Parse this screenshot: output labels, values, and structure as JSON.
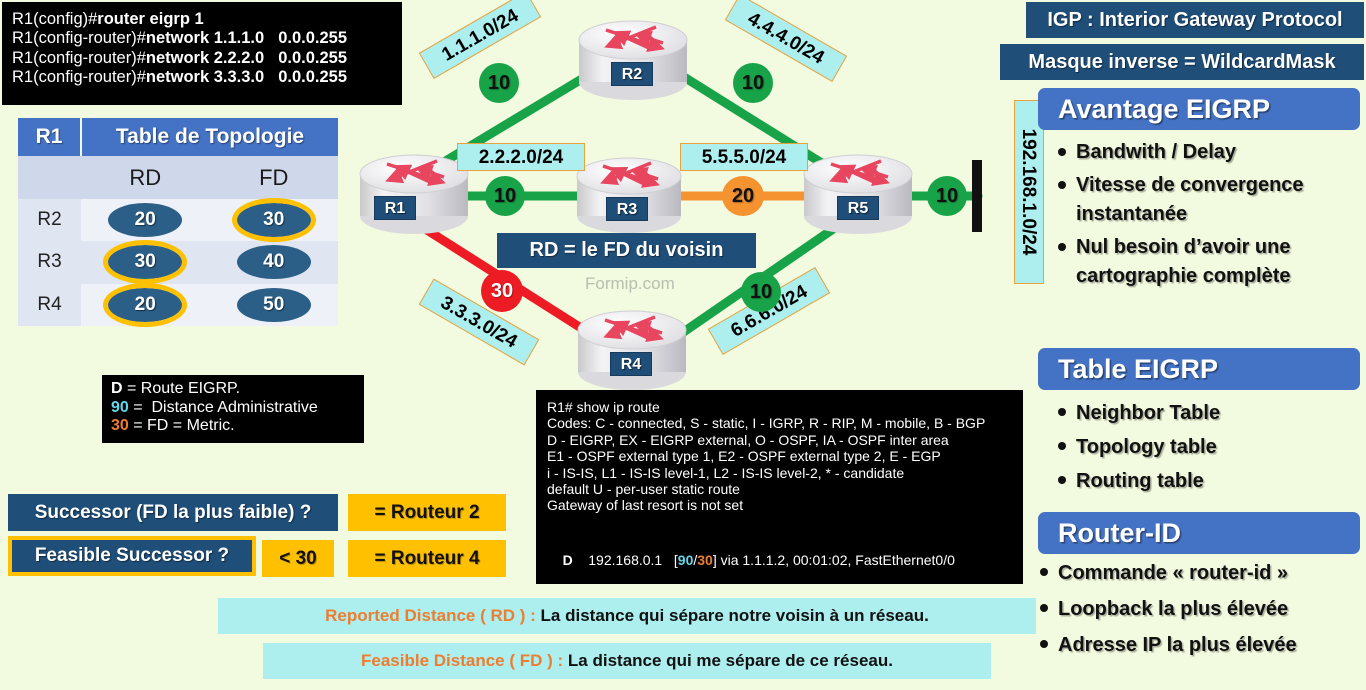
{
  "cli_config": {
    "name": "eigrp-config-terminal",
    "lines": [
      {
        "prompt": "R1(config)#",
        "cmd": "router eigrp 1",
        "mask": ""
      },
      {
        "prompt": "R1(config-router)#",
        "cmd": "network 1.1.1.0",
        "mask": "0.0.0.255"
      },
      {
        "prompt": "R1(config-router)#",
        "cmd": "network 2.2.2.0",
        "mask": "0.0.0.255"
      },
      {
        "prompt": "R1(config-router)#",
        "cmd": "network 3.3.3.0",
        "mask": "0.0.0.255"
      }
    ]
  },
  "topology_table": {
    "router_label": "R1",
    "title": "Table de Topologie",
    "col_headers": [
      "",
      "RD",
      "FD"
    ],
    "rows": [
      {
        "label": "R2",
        "rd": "20",
        "fd": "30",
        "rd_highlight": false,
        "fd_highlight": true
      },
      {
        "label": "R3",
        "rd": "30",
        "fd": "40",
        "rd_highlight": true,
        "fd_highlight": false
      },
      {
        "label": "R4",
        "rd": "20",
        "fd": "50",
        "rd_highlight": true,
        "fd_highlight": false
      }
    ]
  },
  "legend_box": {
    "lines": [
      {
        "key": "D",
        "key_color": "#ffffff",
        "rest": " = Route EIGRP."
      },
      {
        "key": "90",
        "key_color": "#63d6e8",
        "rest": " =  Distance Administrative"
      },
      {
        "key": "30",
        "key_color": "#ED7D31",
        "rest": " = FD = Metric."
      }
    ]
  },
  "successor_block": {
    "successor_question": "Successor (FD la plus faible) ?",
    "successor_answer": "= Routeur 2",
    "feasible_question": "Feasible Successor ?",
    "feasible_condition": "< 30",
    "feasible_answer": "= Routeur 4"
  },
  "show_ip_route": {
    "lines": [
      "R1# show ip route",
      "Codes: C - connected, S - static, I - IGRP, R - RIP, M - mobile, B - BGP",
      "D - EIGRP, EX - EIGRP external, O - OSPF, IA - OSPF inter area",
      "E1 - OSPF external type 1, E2 - OSPF external type 2, E - EGP",
      "i - IS-IS, L1 - IS-IS level-1, L2 - IS-IS level-2, * - candidate",
      "default U - per-user static route",
      "Gateway of last resort is not set"
    ],
    "route": {
      "code": "D",
      "network": "192.168.0.1",
      "ad": "90",
      "metric": "30",
      "tail": "via 1.1.1.2, 00:01:02, FastEthernet0/0"
    }
  },
  "bottom_definitions": [
    {
      "term": "Reported Distance ( RD ) :",
      "text": "La distance qui sépare notre voisin à un réseau."
    },
    {
      "term": "Feasible Distance ( FD ) :",
      "text": "La distance qui me sépare de ce réseau."
    }
  ],
  "right_panel": {
    "banners": [
      "IGP : Interior Gateway Protocol",
      "Masque inverse = WildcardMask"
    ],
    "sections": [
      {
        "title": "Avantage EIGRP",
        "items": [
          "Bandwith / Delay",
          "Vitesse de convergence instantanée",
          "Nul besoin d’avoir une cartographie complète"
        ]
      },
      {
        "title": "Table EIGRP",
        "items": [
          "Neighbor Table",
          "Topology table",
          "Routing table"
        ]
      },
      {
        "title": "Router-ID",
        "items": [
          "Commande « router-id »",
          "Loopback la plus élevée",
          "Adresse IP la plus élevée"
        ]
      }
    ]
  },
  "diagram": {
    "watermark": "Formip.com",
    "note": "RD = le FD du voisin",
    "routers": [
      {
        "id": "R1",
        "label": "R1"
      },
      {
        "id": "R2",
        "label": "R2"
      },
      {
        "id": "R3",
        "label": "R3"
      },
      {
        "id": "R4",
        "label": "R4"
      },
      {
        "id": "R5",
        "label": "R5"
      }
    ],
    "networks": [
      {
        "id": "net-1",
        "label": "1.1.1.0/24"
      },
      {
        "id": "net-2",
        "label": "2.2.2.0/24"
      },
      {
        "id": "net-3",
        "label": "3.3.3.0/24"
      },
      {
        "id": "net-4",
        "label": "4.4.4.0/24"
      },
      {
        "id": "net-5",
        "label": "5.5.5.0/24"
      },
      {
        "id": "net-6",
        "label": "6.6.6.0/24"
      },
      {
        "id": "net-lan",
        "label": "192.168.1.0/24"
      }
    ],
    "metrics": [
      {
        "id": "metric-r1-r2",
        "value": "10",
        "color": "#18A348"
      },
      {
        "id": "metric-r2-r5",
        "value": "10",
        "color": "#18A348"
      },
      {
        "id": "metric-r1-r3",
        "value": "10",
        "color": "#18A348"
      },
      {
        "id": "metric-r3-r5",
        "value": "20",
        "color": "#F59331"
      },
      {
        "id": "metric-r5-lan",
        "value": "10",
        "color": "#18A348"
      },
      {
        "id": "metric-r1-r4",
        "value": "30",
        "color": "#ED1C24"
      },
      {
        "id": "metric-r4-r5",
        "value": "10",
        "color": "#18A348"
      }
    ]
  },
  "colors": {
    "background": "#f2fae0",
    "navy": "#1F4E79",
    "blue_header": "#4472C4",
    "cyan": "#ADEFEF",
    "gold": "#FFC000",
    "green_link": "#18A348",
    "orange_link": "#F59331",
    "red_link": "#ED1C24"
  }
}
